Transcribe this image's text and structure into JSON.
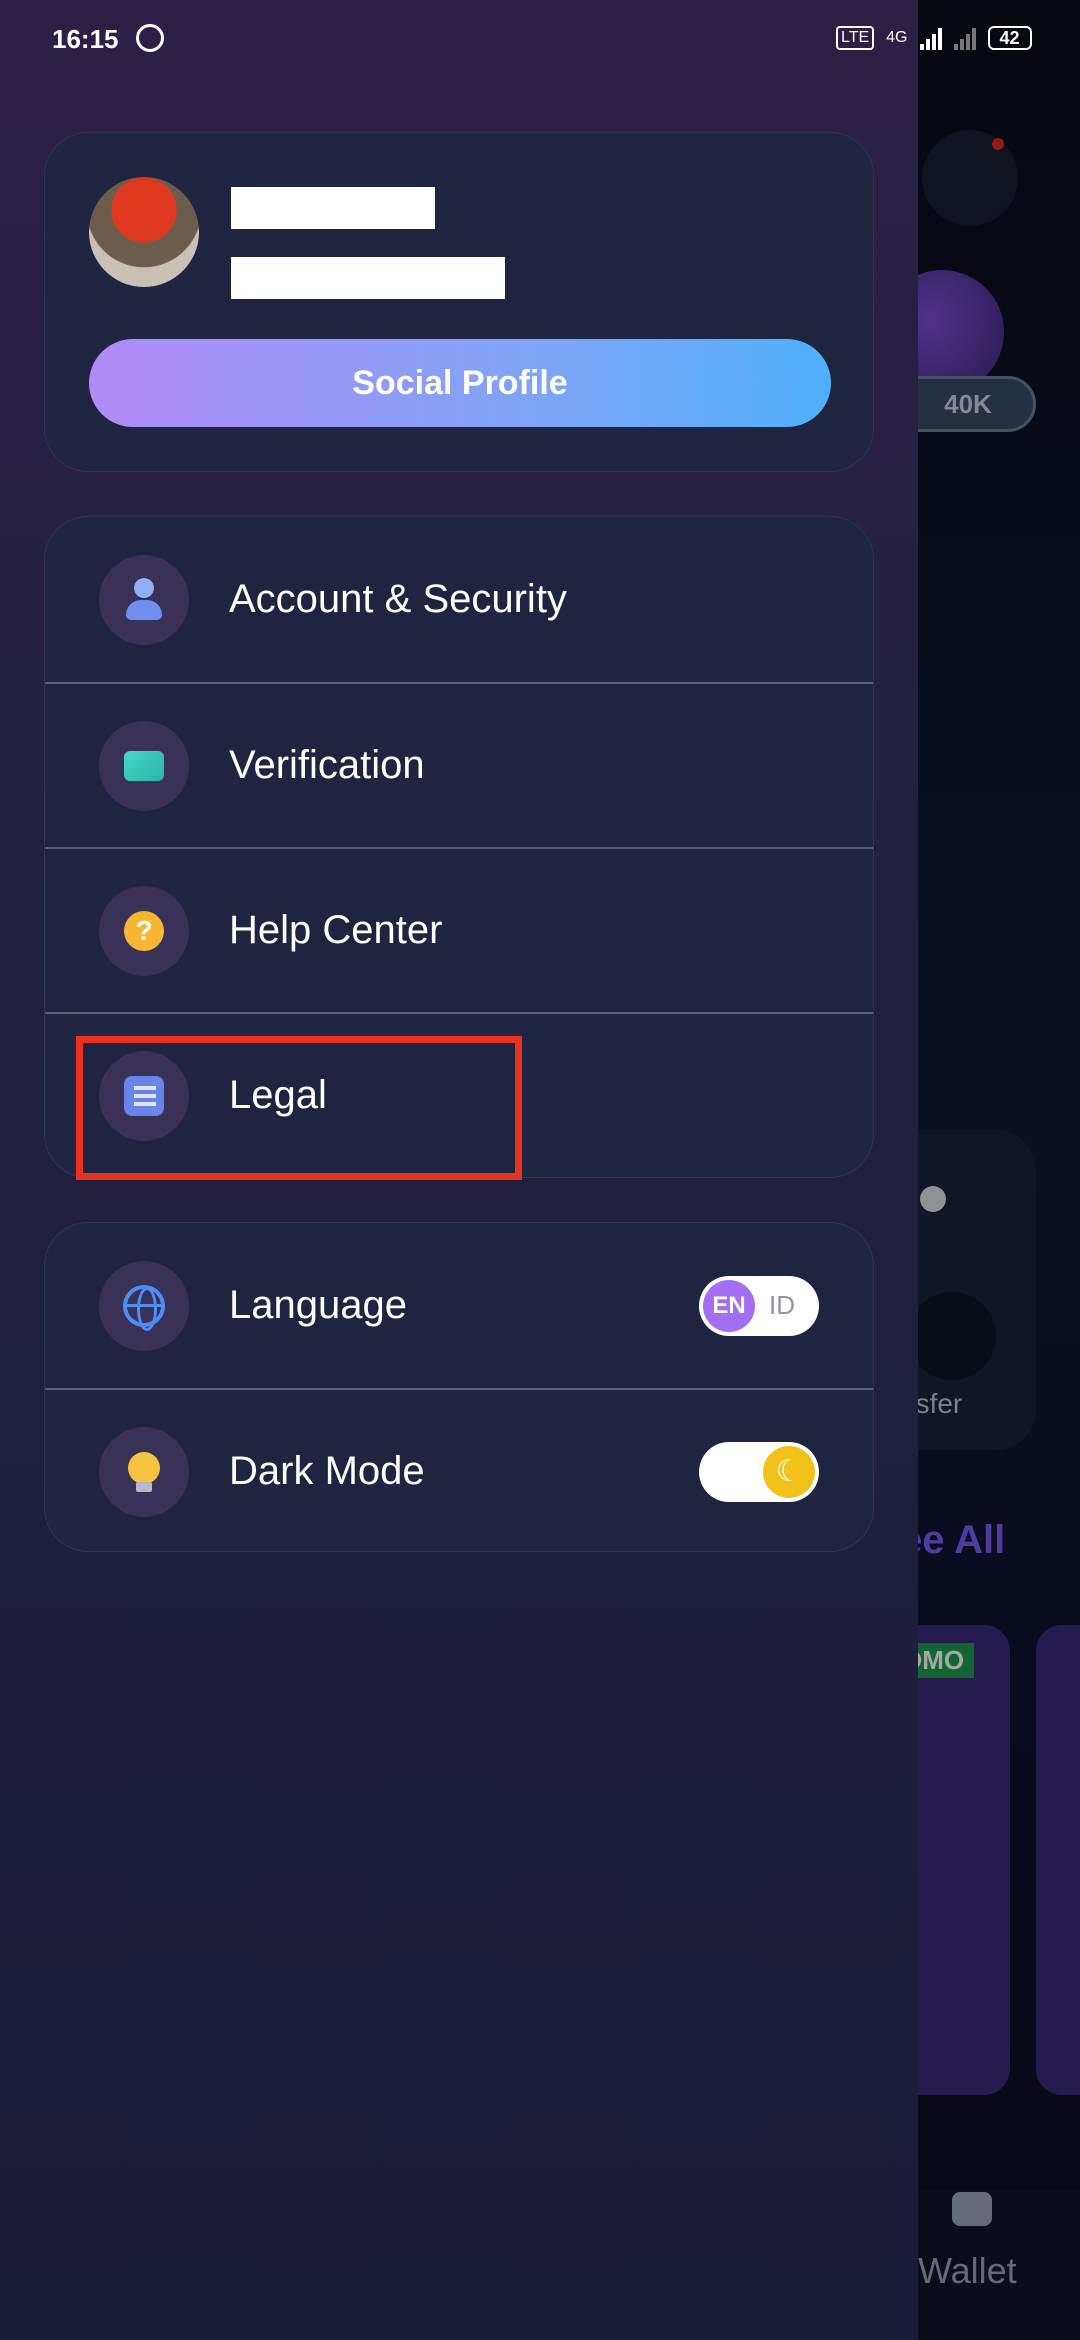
{
  "status_bar": {
    "time": "16:15",
    "network": "4G",
    "battery": "42"
  },
  "background": {
    "balance_badge": "40K",
    "transfer_label": "nsfer",
    "see_all": "ee All",
    "promo_tag": "OMO",
    "wallet_label": "Wallet"
  },
  "drawer": {
    "social_profile_label": "Social Profile",
    "menu": [
      {
        "label": "Account & Security",
        "icon": "user-icon"
      },
      {
        "label": "Verification",
        "icon": "id-card-icon"
      },
      {
        "label": "Help Center",
        "icon": "help-icon"
      },
      {
        "label": "Legal",
        "icon": "document-icon"
      }
    ],
    "settings": [
      {
        "label": "Language",
        "icon": "globe-icon",
        "toggle_on": "EN",
        "toggle_off": "ID"
      },
      {
        "label": "Dark Mode",
        "icon": "bulb-icon",
        "toggle_glyph": "☾"
      }
    ]
  },
  "colors": {
    "accent_highlight": "#e8321f",
    "button_gradient_start": "#b18af7",
    "button_gradient_end": "#4fb0fb"
  }
}
